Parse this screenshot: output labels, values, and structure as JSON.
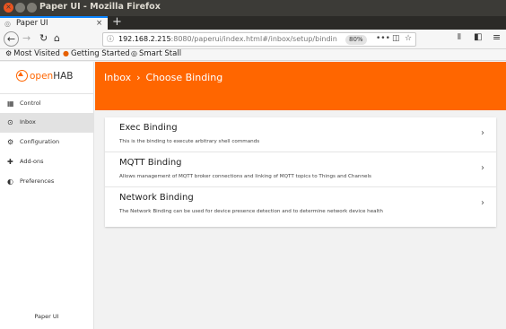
{
  "window": {
    "title": "Paper UI - Mozilla Firefox",
    "close_glyph": "×"
  },
  "browser": {
    "tab_title": "Paper UI",
    "tab_close": "×",
    "new_tab": "+",
    "url_host": "192.168.2.215",
    "url_rest": ":8080/paperui/index.html#/inbox/setup/bindin",
    "zoom": "80%",
    "bookmarks": [
      {
        "label": "Most Visited",
        "icon": "gear-icon"
      },
      {
        "label": "Getting Started",
        "icon": "firefox-icon"
      },
      {
        "label": "Smart Stall",
        "icon": "globe-icon"
      }
    ]
  },
  "sidebar": {
    "logo_open": "open",
    "logo_hab": "HAB",
    "items": [
      {
        "label": "Control",
        "icon": "grid-icon"
      },
      {
        "label": "Inbox",
        "icon": "inbox-icon"
      },
      {
        "label": "Configuration",
        "icon": "gear-icon"
      },
      {
        "label": "Add-ons",
        "icon": "puzzle-icon"
      },
      {
        "label": "Preferences",
        "icon": "contrast-icon"
      }
    ],
    "active_index": 1,
    "footer": "Paper UI"
  },
  "header": {
    "crumb_root": "Inbox",
    "crumb_sep": "›",
    "crumb_current": "Choose Binding"
  },
  "bindings": [
    {
      "title": "Exec Binding",
      "description": "This is the binding to execute arbitrary shell commands"
    },
    {
      "title": "MQTT Binding",
      "description": "Allows management of MQTT broker connections and linking of MQTT topics to Things and Channels"
    },
    {
      "title": "Network Binding",
      "description": "The Network Binding can be used for device presence detection and to determine network device health"
    }
  ],
  "colors": {
    "accent": "#ff6600",
    "titlebar": "#3c3b37",
    "close_button": "#e95420"
  }
}
